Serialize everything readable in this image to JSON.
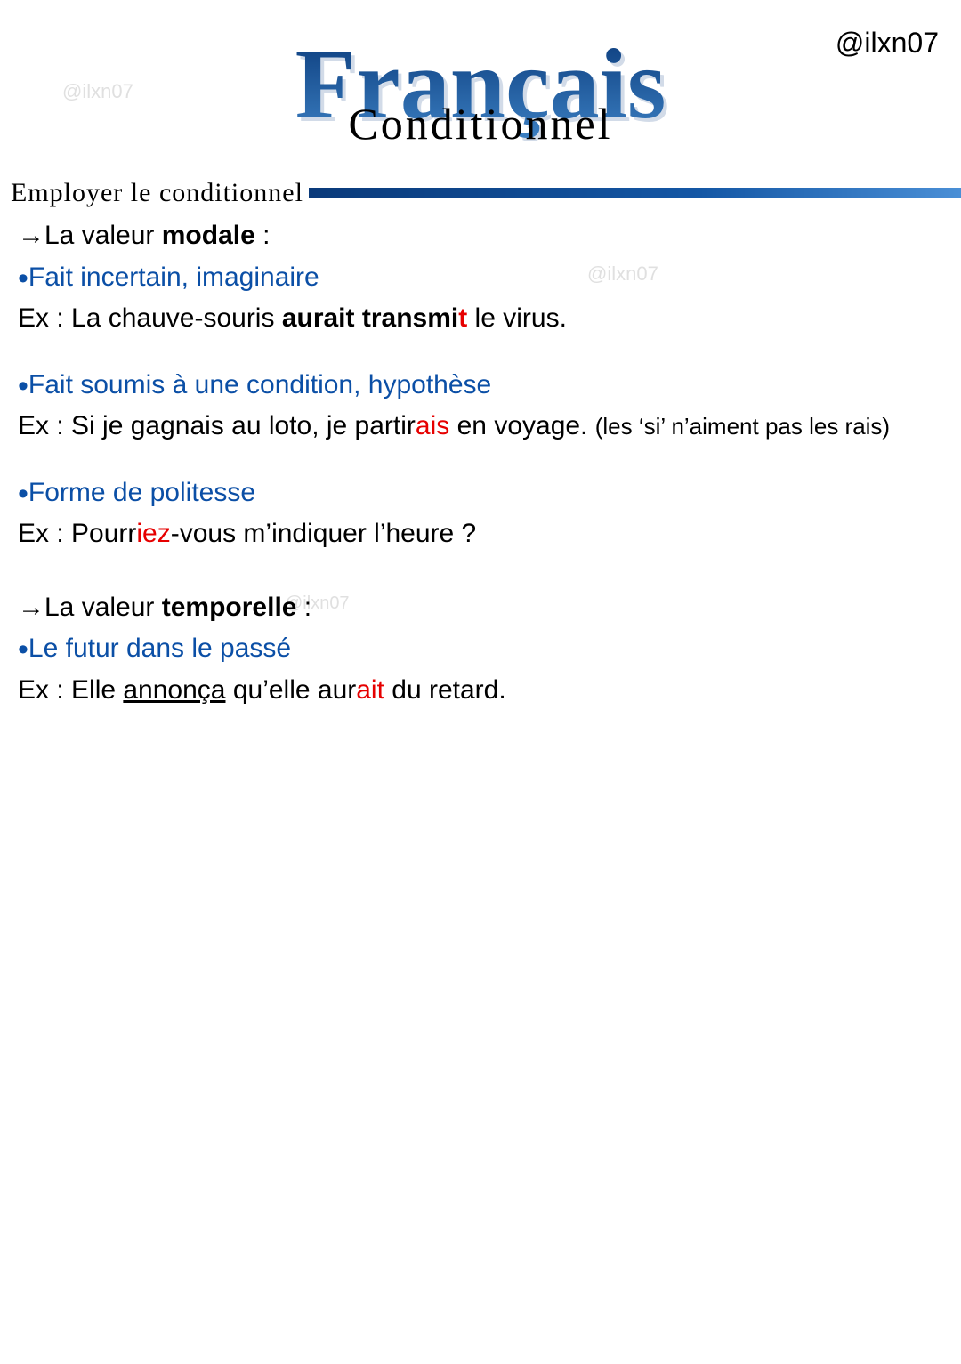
{
  "handle": "@ilxn07",
  "watermark": "@ilxn07",
  "hero": {
    "title": "Français",
    "subtitle": "Conditionnel"
  },
  "section_title": "Employer le conditionnel",
  "modal": {
    "heading_prefix": "La valeur ",
    "heading_bold": "modale",
    "heading_suffix": " :",
    "b1": {
      "head": "Fait incertain, imaginaire",
      "ex_pre": "Ex : La chauve-souris ",
      "ex_bold": "aurait transmi",
      "ex_red": "t",
      "ex_post": " le virus."
    },
    "b2": {
      "head": "Fait soumis à une condition, hypothèse",
      "ex_pre": "Ex : Si je gagnais au loto, je partir",
      "ex_red": "ais",
      "ex_post": " en voyage. ",
      "ann": "(les ‘si’ n’aiment pas les rais)"
    },
    "b3": {
      "head": "Forme de politesse",
      "ex_pre": "Ex : Pourr",
      "ex_red": "iez",
      "ex_post": "-vous m’indiquer l’heure ?"
    }
  },
  "temporal": {
    "heading_prefix": "La valeur ",
    "heading_bold": "temporelle",
    "heading_suffix": " :",
    "b1": {
      "head": "Le futur dans le passé",
      "ex_pre": "Ex : Elle ",
      "ex_u": "annonça",
      "ex_mid": " qu’elle aur",
      "ex_red": "ait",
      "ex_post": " du retard."
    }
  }
}
